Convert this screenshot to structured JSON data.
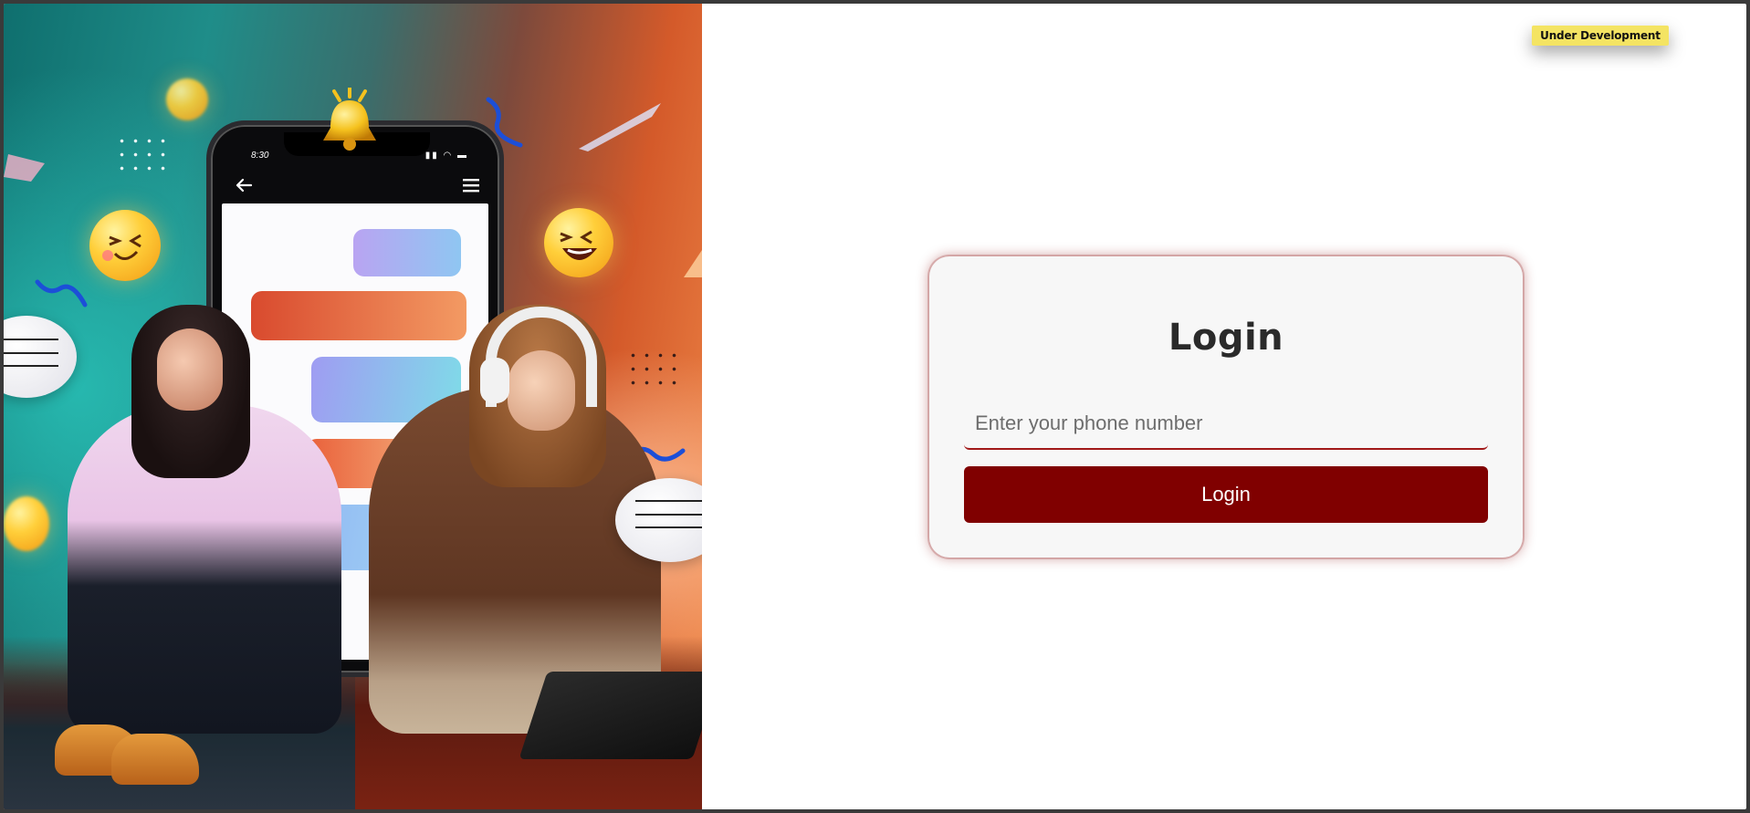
{
  "badge": {
    "label": "Under Development",
    "color": "#f4e463"
  },
  "phone_mock": {
    "time": "8:30"
  },
  "login": {
    "title": "Login",
    "phone_placeholder": "Enter your phone number",
    "phone_value": "",
    "button_label": "Login",
    "button_color": "#800000",
    "accent_color": "#a11818"
  },
  "icons": {
    "back": "arrow-left-icon",
    "menu": "hamburger-menu-icon",
    "bell": "bell-icon",
    "emoji": "laughing-emoji-icon",
    "chat": "chat-bubble-icon"
  }
}
